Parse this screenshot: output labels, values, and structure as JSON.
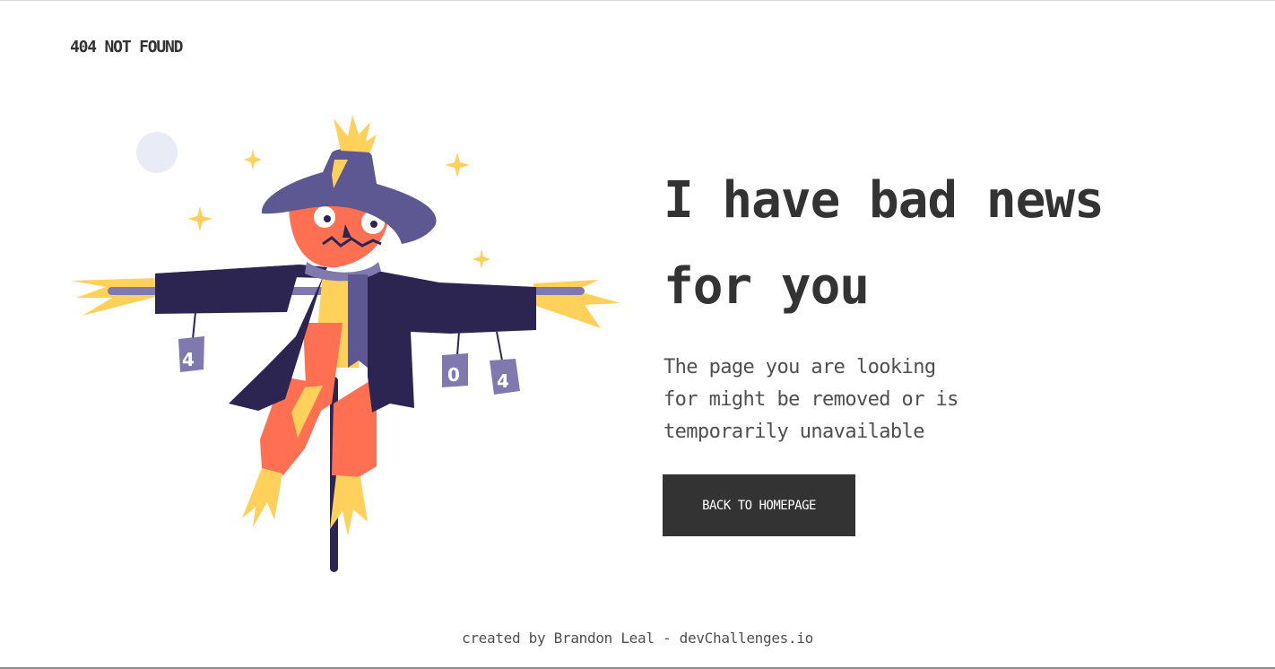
{
  "header": {
    "logo_text": "404 NOT FOUND"
  },
  "illustration": {
    "icon": "scarecrow-illustration",
    "can_labels": [
      "4",
      "0",
      "4"
    ],
    "colors": {
      "hat": "#5d5792",
      "coat": "#2c2551",
      "face": "#ff6f52",
      "straw": "#ffd15b",
      "moon": "#e9ecf6",
      "cans": "#7f79b0"
    }
  },
  "main": {
    "headline_line1": "I have bad news",
    "headline_line2": "for you",
    "message_line1": "The page you are looking",
    "message_line2": "for might be removed or is",
    "message_line3": "temporarily unavailable",
    "button_label": "BACK TO HOMEPAGE"
  },
  "footer": {
    "credit": "created by Brandon Leal - devChallenges.io"
  },
  "colors": {
    "text": "#333333",
    "muted_text": "#4f4f4f",
    "button_bg": "#333333",
    "button_text": "#ffffff",
    "background": "#ffffff"
  }
}
